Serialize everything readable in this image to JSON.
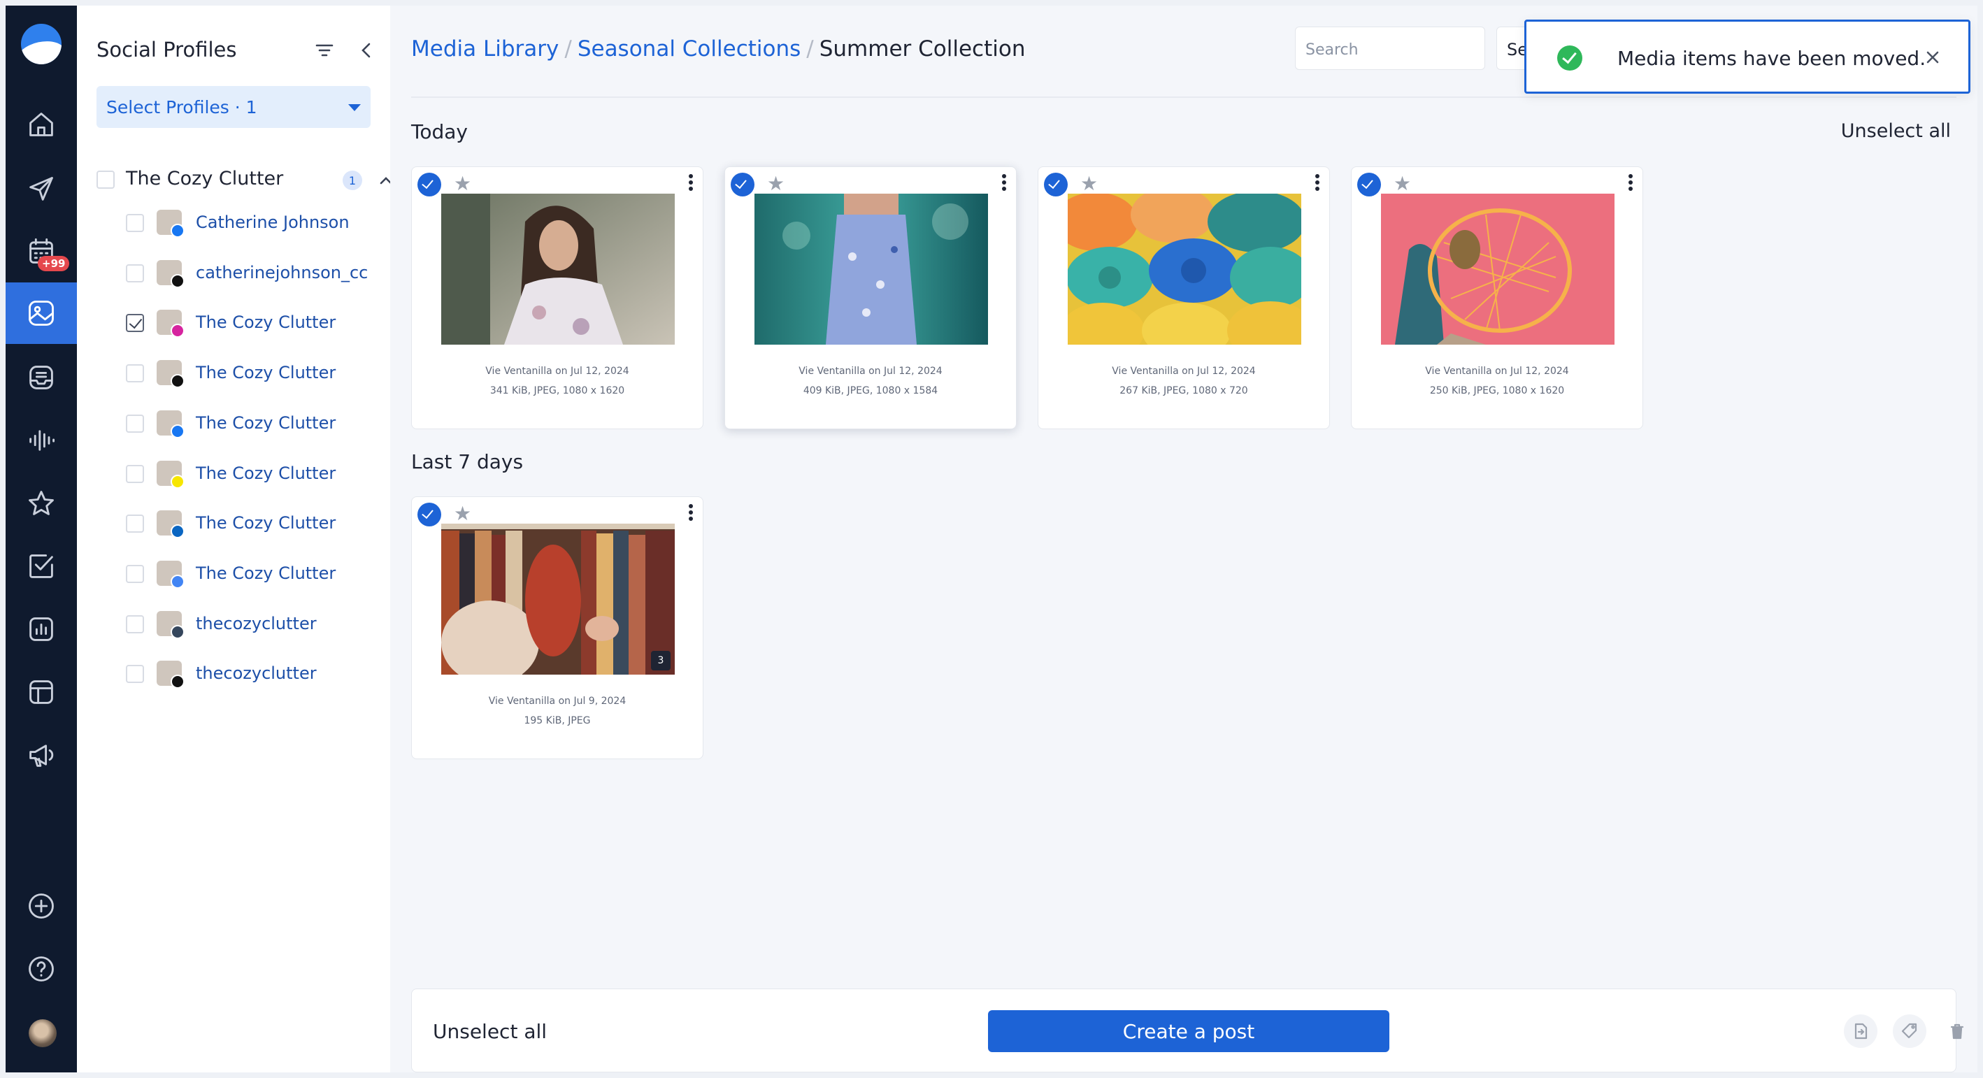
{
  "sidebar": {
    "calendar_badge": "+99"
  },
  "profiles_panel": {
    "title": "Social Profiles",
    "select_label": "Select Profiles · 1",
    "group": {
      "name": "The Cozy Clutter",
      "count": "1"
    },
    "profiles": [
      {
        "name": "Catherine Johnson",
        "network": "facebook",
        "checked": false,
        "network_color": "#1877f2"
      },
      {
        "name": "catherinejohnson_cc",
        "network": "threads",
        "checked": false,
        "network_color": "#111111"
      },
      {
        "name": "The Cozy Clutter",
        "network": "instagram",
        "checked": true,
        "network_color": "#d6249f"
      },
      {
        "name": "The Cozy Clutter",
        "network": "x",
        "checked": false,
        "network_color": "#111111"
      },
      {
        "name": "The Cozy Clutter",
        "network": "facebook",
        "checked": false,
        "network_color": "#1877f2"
      },
      {
        "name": "The Cozy Clutter",
        "network": "snapchat",
        "checked": false,
        "network_color": "#f7e600"
      },
      {
        "name": "The Cozy Clutter",
        "network": "linkedin",
        "checked": false,
        "network_color": "#0a66c2"
      },
      {
        "name": "The Cozy Clutter",
        "network": "google-business",
        "checked": false,
        "network_color": "#4285f4"
      },
      {
        "name": "thecozyclutter",
        "network": "tumblr",
        "checked": false,
        "network_color": "#35465c"
      },
      {
        "name": "thecozyclutter",
        "network": "tiktok",
        "checked": false,
        "network_color": "#111111"
      }
    ]
  },
  "header": {
    "breadcrumbs": [
      "Media Library",
      "Seasonal Collections",
      "Summer Collection"
    ],
    "search_placeholder": "Search",
    "second_field_text": "Se"
  },
  "toast": {
    "message": "Media items have been moved."
  },
  "main": {
    "unselect_all": "Unselect all",
    "sections": [
      {
        "label": "Today",
        "items": [
          {
            "author": "Vie Ventanilla on Jul 12, 2024",
            "details": "341 KiB, JPEG, 1080 x 1620",
            "selected": true
          },
          {
            "author": "Vie Ventanilla on Jul 12, 2024",
            "details": "409 KiB, JPEG, 1080 x 1584",
            "selected": true
          },
          {
            "author": "Vie Ventanilla on Jul 12, 2024",
            "details": "267 KiB, JPEG, 1080 x 720",
            "selected": true
          },
          {
            "author": "Vie Ventanilla on Jul 12, 2024",
            "details": "250 KiB, JPEG, 1080 x 1620",
            "selected": true
          }
        ]
      },
      {
        "label": "Last 7 days",
        "items": [
          {
            "author": "Vie Ventanilla on Jul 9, 2024",
            "details": "195 KiB, JPEG",
            "selected": true,
            "count": "3"
          }
        ]
      }
    ]
  },
  "bottom_bar": {
    "unselect_all": "Unselect all",
    "create_post": "Create a post"
  },
  "colors": {
    "accent": "#1d63d6",
    "rail": "#0f1a2e",
    "success": "#2fb85a"
  }
}
